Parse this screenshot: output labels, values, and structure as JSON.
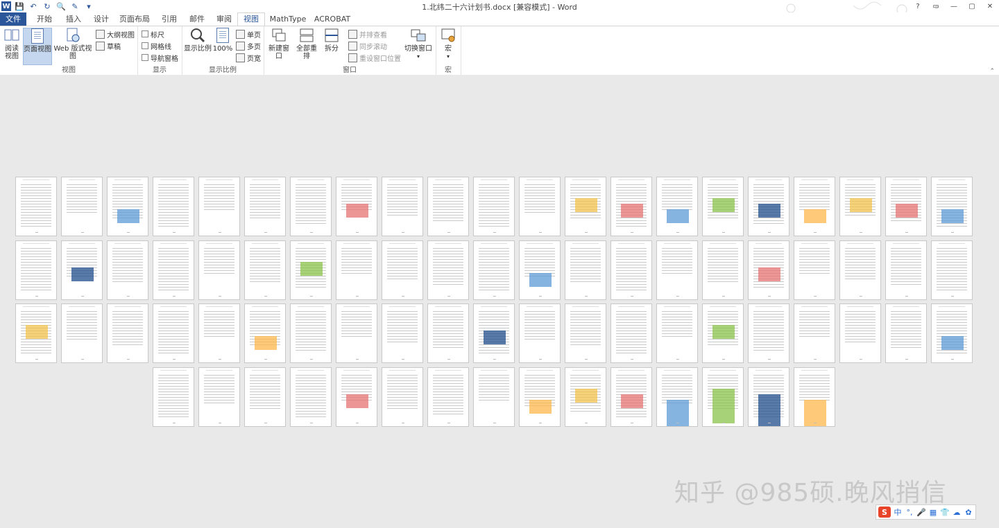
{
  "window": {
    "title": "1.北纬二十六计划书.docx [兼容模式] - Word",
    "controls": [
      "?",
      "▭",
      "—",
      "▢",
      "✕"
    ]
  },
  "tabs": [
    {
      "label": "文件"
    },
    {
      "label": "开始"
    },
    {
      "label": "插入"
    },
    {
      "label": "设计"
    },
    {
      "label": "页面布局"
    },
    {
      "label": "引用"
    },
    {
      "label": "邮件"
    },
    {
      "label": "审阅"
    },
    {
      "label": "视图"
    },
    {
      "label": "MathType"
    },
    {
      "label": "ACROBAT"
    }
  ],
  "active_tab": "视图",
  "ribbon": {
    "views": {
      "label": "视图",
      "read_mode": "阅读\n视图",
      "print_layout": "页面视图",
      "web_layout": "Web 版式视图",
      "outline": "大纲视图",
      "draft": "草稿"
    },
    "show": {
      "label": "显示",
      "ruler": "标尺",
      "gridlines": "网格线",
      "nav_pane": "导航窗格"
    },
    "zoom": {
      "label": "显示比例",
      "zoom": "显示比例",
      "hundred": "100%",
      "one_page": "单页",
      "multi_page": "多页",
      "page_width": "页宽"
    },
    "window": {
      "label": "窗口",
      "new_window": "新建窗口",
      "arrange_all": "全部重排",
      "split": "拆分",
      "side_by_side": "并排查看",
      "sync_scroll": "同步滚动",
      "reset_pos": "重设窗口位置",
      "switch_windows": "切换窗口"
    },
    "macros": {
      "label": "宏",
      "macros": "宏"
    }
  },
  "watermark": "知乎 @985硕.晚风捎信",
  "ime": {
    "logo": "S",
    "items": [
      "中",
      "°,",
      "🎤",
      "▦",
      "👕",
      "☁",
      "✿"
    ]
  },
  "colors": {
    "word_blue": "#2b579a",
    "selected_btn": "#c5d7ee",
    "workspace": "#e9e9e9"
  }
}
